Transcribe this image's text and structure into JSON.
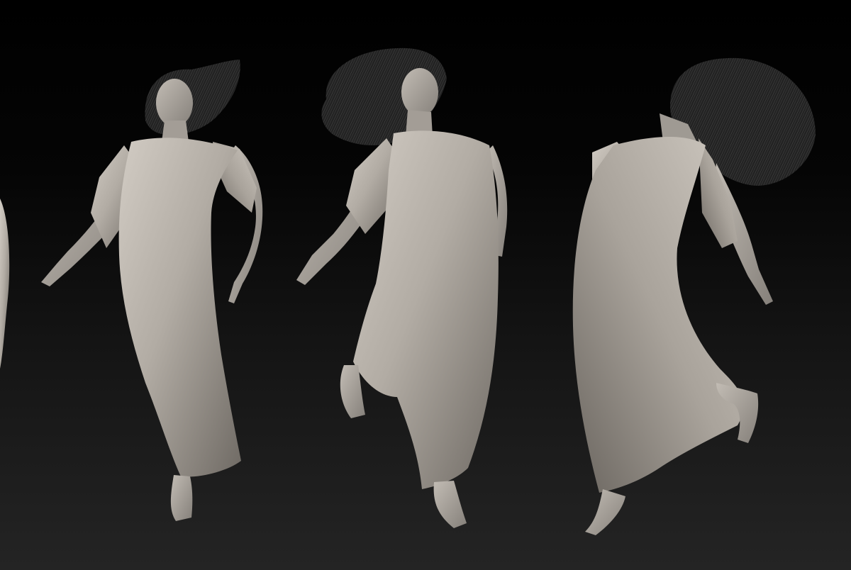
{
  "scene": {
    "background_top": "#000000",
    "background_bottom": "#242424",
    "skin_color": "#a9a29a",
    "dress_color": "#b2aca4",
    "hair_color": "#262626",
    "figure_count": 4,
    "render_style": "grey clay 3D sculpt"
  }
}
